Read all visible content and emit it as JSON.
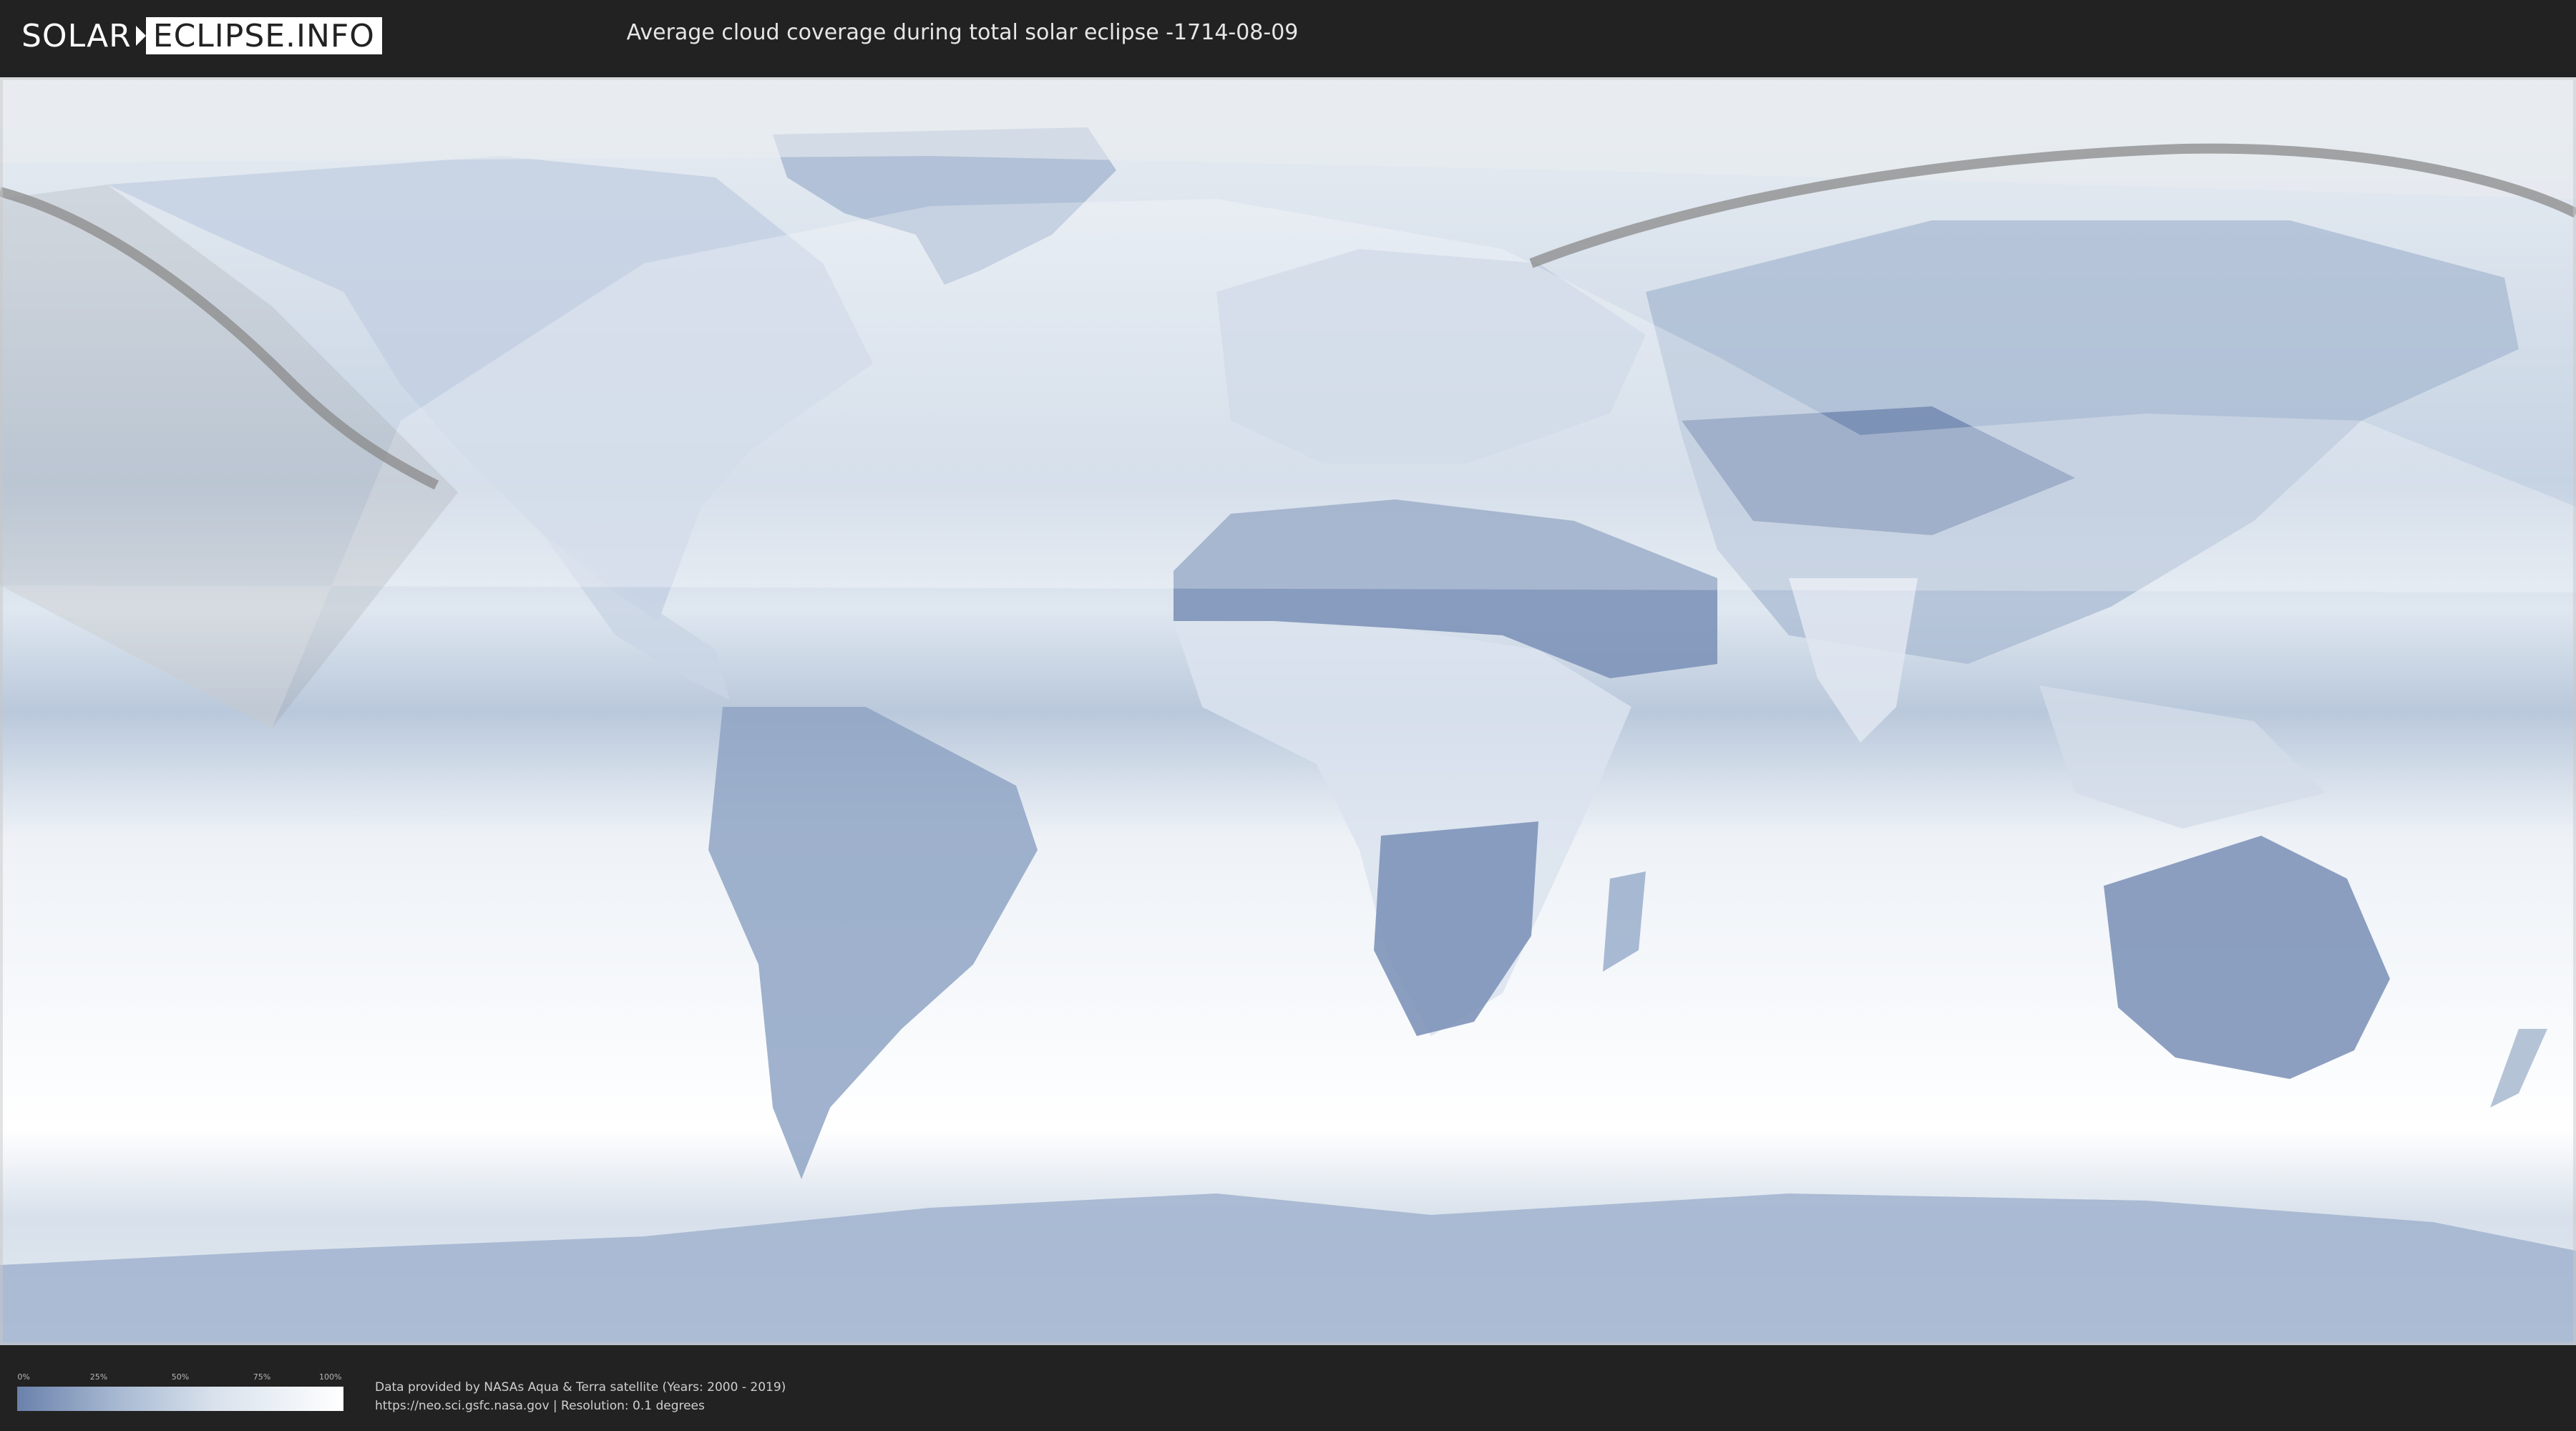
{
  "header": {
    "logo_left": "SOLAR",
    "logo_right": "ECLIPSE.INFO",
    "title": "Average cloud coverage during total solar eclipse -1714-08-09"
  },
  "legend": {
    "ticks": [
      "0%",
      "25%",
      "50%",
      "75%",
      "100%"
    ],
    "colors": {
      "low": "#6a81ab",
      "high": "#ffffff"
    }
  },
  "credits": {
    "line1": "Data provided by NASAs Aqua & Terra satellite (Years: 2000 - 2019)",
    "line2": "https://neo.sci.gsfc.nasa.gov | Resolution: 0.1 degrees"
  },
  "colors": {
    "background": "#222222",
    "clear_sky": "#6a81ab",
    "cloudy": "#ffffff",
    "path": "#8a8a8a"
  }
}
